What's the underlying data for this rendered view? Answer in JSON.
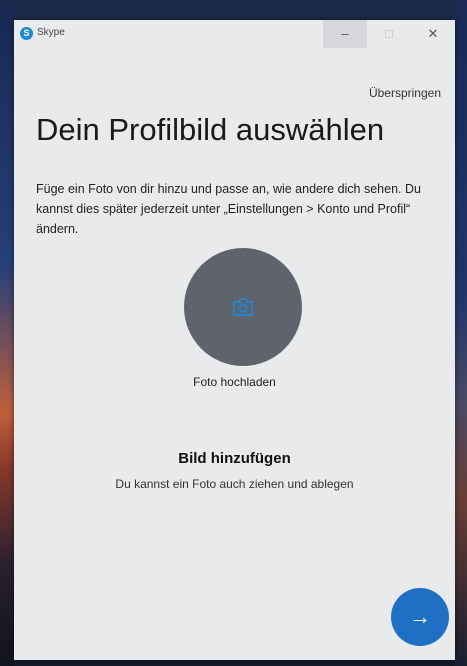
{
  "window": {
    "app_name": "Skype",
    "app_icon_letter": "S",
    "controls": {
      "minimize": "–",
      "maximize": "□",
      "close": "✕"
    }
  },
  "header": {
    "skip_label": "Überspringen"
  },
  "main": {
    "title": "Dein Profilbild auswählen",
    "description": "Füge ein Foto von dir hinzu und passe an, wie andere dich sehen. Du kannst dies später jederzeit unter „Einstellungen > Konto und Profil“ ändern.",
    "upload_label": "Foto hochladen",
    "add_heading": "Bild hinzufügen",
    "add_subtext": "Du kannst ein Foto auch ziehen und ablegen"
  },
  "footer": {
    "next_icon": "→"
  },
  "icons": {
    "upload": "camera-icon",
    "next": "arrow-right-icon"
  },
  "colors": {
    "accent": "#1f6fc4",
    "avatar_bg": "#5f636c",
    "window_bg": "#e9eaec",
    "icon_blue": "#1e88d6"
  }
}
